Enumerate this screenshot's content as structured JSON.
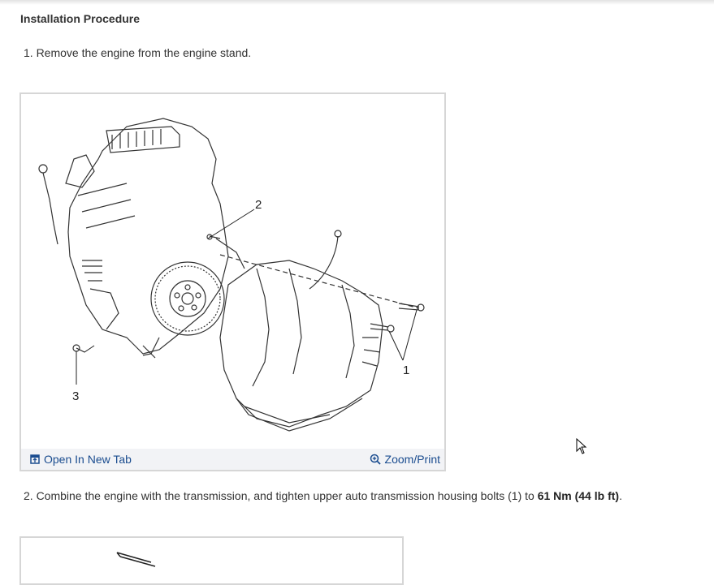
{
  "section": {
    "title": "Installation Procedure"
  },
  "steps": [
    {
      "text": "1. Remove the engine from the engine stand."
    },
    {
      "prefix": "2. Combine the engine with the transmission, and tighten upper auto transmission housing bolts (1) to ",
      "torque": "61 Nm (44 lb ft)",
      "suffix": "."
    }
  ],
  "figure1": {
    "callouts": [
      "1",
      "2",
      "3"
    ],
    "open_label": "Open In New Tab",
    "zoom_label": "Zoom/Print",
    "open_icon": "open-new-tab-icon",
    "zoom_icon": "zoom-icon"
  },
  "colors": {
    "link": "#1a4c8f",
    "border": "#d6d6d6",
    "bar": "#f2f3f6"
  }
}
